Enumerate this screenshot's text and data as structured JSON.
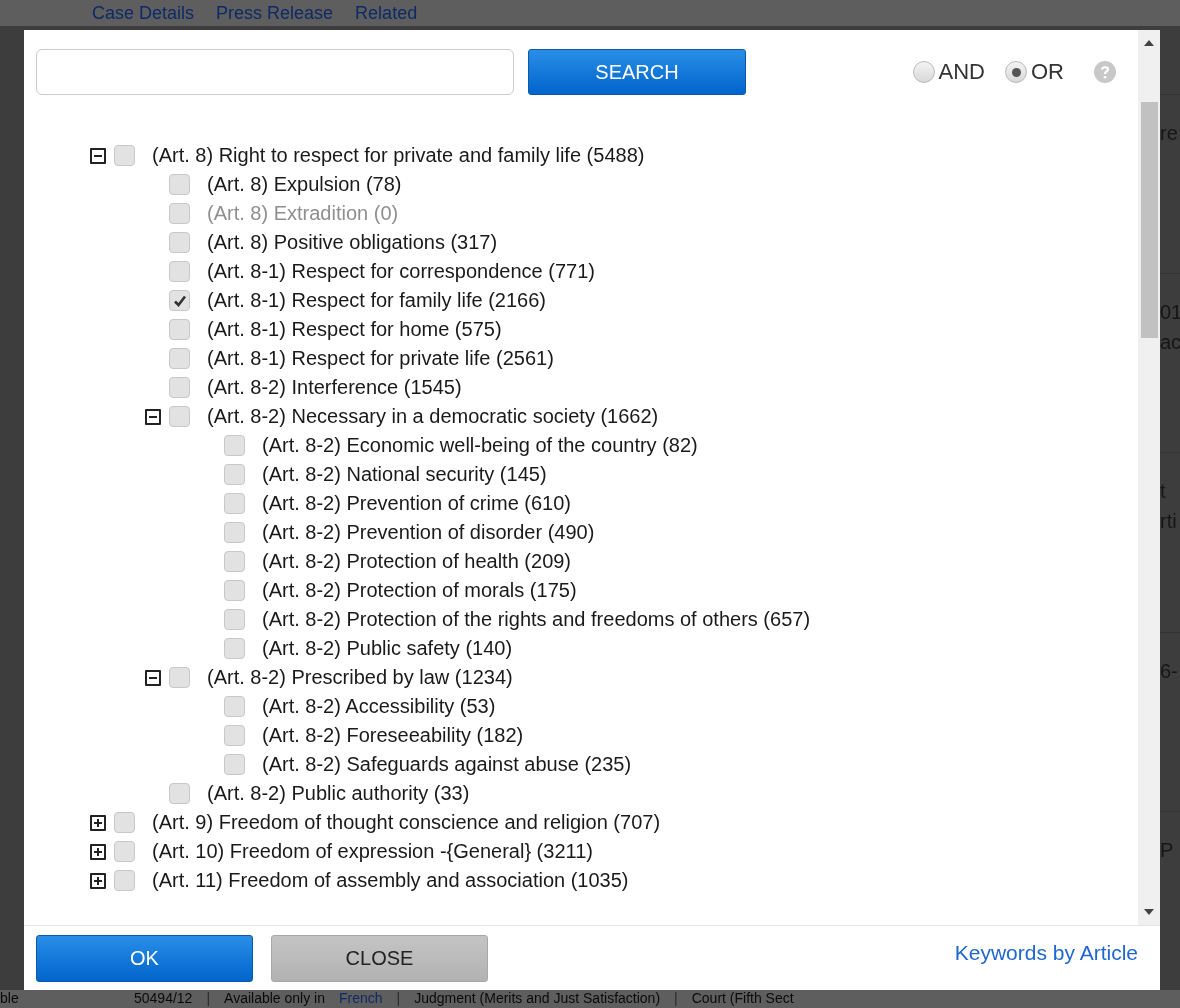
{
  "background_page": {
    "tabs": [
      "Case Details",
      "Press Release",
      "Related"
    ],
    "right_fragments": [
      [
        "re"
      ],
      [
        "01",
        "ac"
      ],
      [
        "t",
        "rti"
      ],
      [
        "6-"
      ],
      [
        "P"
      ]
    ],
    "bottom_left": "ble",
    "bottom_row": [
      {
        "kind": "text",
        "text": "50494/12"
      },
      {
        "kind": "sep",
        "text": "|"
      },
      {
        "kind": "text",
        "text": "Available only in"
      },
      {
        "kind": "link",
        "text": "French"
      },
      {
        "kind": "sep",
        "text": "|"
      },
      {
        "kind": "text",
        "text": "Judgment (Merits and Just Satisfaction)"
      },
      {
        "kind": "sep",
        "text": "|"
      },
      {
        "kind": "text",
        "text": "Court (Fifth Sect"
      }
    ]
  },
  "dialog": {
    "search": {
      "button": "SEARCH"
    },
    "operators": [
      {
        "label": "AND",
        "selected": false
      },
      {
        "label": "OR",
        "selected": true
      }
    ],
    "tree": [
      {
        "kind": "group",
        "label": "(Art. 8) Right to respect for private and family life (5488)",
        "expanded": true,
        "checked": false,
        "disabled": false,
        "children": [
          {
            "kind": "leaf",
            "label": "(Art. 8) Expulsion (78)",
            "checked": false,
            "disabled": false
          },
          {
            "kind": "leaf",
            "label": "(Art. 8) Extradition (0)",
            "checked": false,
            "disabled": true
          },
          {
            "kind": "leaf",
            "label": "(Art. 8) Positive obligations (317)",
            "checked": false,
            "disabled": false
          },
          {
            "kind": "leaf",
            "label": "(Art. 8-1) Respect for correspondence (771)",
            "checked": false,
            "disabled": false
          },
          {
            "kind": "leaf",
            "label": "(Art. 8-1) Respect for family life (2166)",
            "checked": true,
            "disabled": false
          },
          {
            "kind": "leaf",
            "label": "(Art. 8-1) Respect for home (575)",
            "checked": false,
            "disabled": false
          },
          {
            "kind": "leaf",
            "label": "(Art. 8-1) Respect for private life (2561)",
            "checked": false,
            "disabled": false
          },
          {
            "kind": "leaf",
            "label": "(Art. 8-2) Interference (1545)",
            "checked": false,
            "disabled": false
          },
          {
            "kind": "group",
            "label": "(Art. 8-2) Necessary in a democratic society (1662)",
            "expanded": true,
            "checked": false,
            "disabled": false,
            "children": [
              {
                "kind": "leaf",
                "label": "(Art. 8-2) Economic well-being of the country (82)",
                "checked": false,
                "disabled": false
              },
              {
                "kind": "leaf",
                "label": "(Art. 8-2) National security (145)",
                "checked": false,
                "disabled": false
              },
              {
                "kind": "leaf",
                "label": "(Art. 8-2) Prevention of crime (610)",
                "checked": false,
                "disabled": false
              },
              {
                "kind": "leaf",
                "label": "(Art. 8-2) Prevention of disorder (490)",
                "checked": false,
                "disabled": false
              },
              {
                "kind": "leaf",
                "label": "(Art. 8-2) Protection of health (209)",
                "checked": false,
                "disabled": false
              },
              {
                "kind": "leaf",
                "label": "(Art. 8-2) Protection of morals (175)",
                "checked": false,
                "disabled": false
              },
              {
                "kind": "leaf",
                "label": "(Art. 8-2) Protection of the rights and freedoms of others (657)",
                "checked": false,
                "disabled": false
              },
              {
                "kind": "leaf",
                "label": "(Art. 8-2) Public safety (140)",
                "checked": false,
                "disabled": false
              }
            ]
          },
          {
            "kind": "group",
            "label": "(Art. 8-2) Prescribed by law (1234)",
            "expanded": true,
            "checked": false,
            "disabled": false,
            "children": [
              {
                "kind": "leaf",
                "label": "(Art. 8-2) Accessibility (53)",
                "checked": false,
                "disabled": false
              },
              {
                "kind": "leaf",
                "label": "(Art. 8-2) Foreseeability (182)",
                "checked": false,
                "disabled": false
              },
              {
                "kind": "leaf",
                "label": "(Art. 8-2) Safeguards against abuse (235)",
                "checked": false,
                "disabled": false
              }
            ]
          },
          {
            "kind": "leaf",
            "label": "(Art. 8-2) Public authority (33)",
            "checked": false,
            "disabled": false
          }
        ]
      },
      {
        "kind": "group",
        "label": "(Art. 9) Freedom of thought conscience and religion (707)",
        "expanded": false,
        "checked": false,
        "disabled": false
      },
      {
        "kind": "group",
        "label": "(Art. 10) Freedom of expression -{General} (3211)",
        "expanded": false,
        "checked": false,
        "disabled": false
      },
      {
        "kind": "group",
        "label": "(Art. 11) Freedom of assembly and association (1035)",
        "expanded": false,
        "checked": false,
        "disabled": false
      }
    ],
    "footer": {
      "ok": "OK",
      "close": "CLOSE",
      "link": "Keywords by Article"
    }
  }
}
